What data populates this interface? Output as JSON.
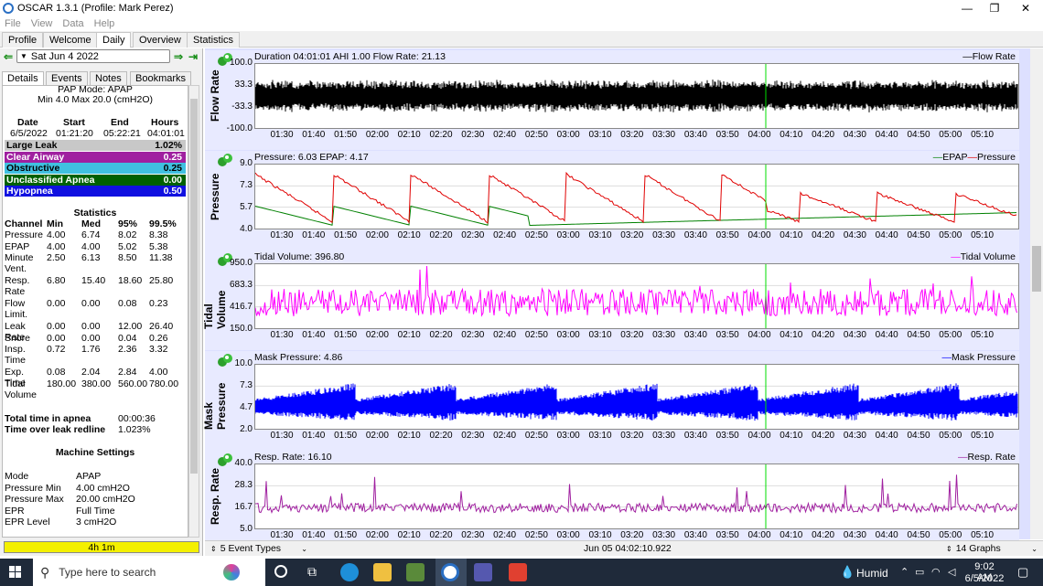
{
  "window": {
    "title": "OSCAR 1.3.1 (Profile: Mark Perez)"
  },
  "menu": [
    "File",
    "View",
    "Data",
    "Help"
  ],
  "tabs": [
    "Profile",
    "Welcome",
    "Daily",
    "Overview",
    "Statistics"
  ],
  "date_nav": {
    "date": "Sat Jun 4 2022"
  },
  "subtabs": [
    "Details",
    "Events",
    "Notes",
    "Bookmarks"
  ],
  "details": {
    "pap_mode": "PAP Mode: APAP",
    "pressure_range": "Min 4.0 Max 20.0 (cmH2O)",
    "session_headers": [
      "Date",
      "Start",
      "End",
      "Hours"
    ],
    "session": [
      "6/5/2022",
      "01:21:20",
      "05:22:21",
      "04:01:01"
    ],
    "events": [
      {
        "name": "Large Leak",
        "value": "1.02%",
        "color": "#c8c8c8",
        "text": "#000"
      },
      {
        "name": "Clear Airway",
        "value": "0.25",
        "color": "#a020a0",
        "text": "#fff"
      },
      {
        "name": "Obstructive",
        "value": "0.25",
        "color": "#40c0e0",
        "text": "#000"
      },
      {
        "name": "Unclassified Apnea",
        "value": "0.00",
        "color": "#006000",
        "text": "#fff"
      },
      {
        "name": "Hypopnea",
        "value": "0.50",
        "color": "#1010e0",
        "text": "#fff"
      }
    ],
    "stats_title": "Statistics",
    "stats_headers": [
      "Channel",
      "Min",
      "Med",
      "95%",
      "99.5%"
    ],
    "stats": [
      {
        "c": "Pressure",
        "v": [
          "4.00",
          "6.74",
          "8.02",
          "8.38"
        ]
      },
      {
        "c": "EPAP",
        "v": [
          "4.00",
          "4.00",
          "5.02",
          "5.38"
        ]
      },
      {
        "c": "Minute Vent.",
        "v": [
          "2.50",
          "6.13",
          "8.50",
          "11.38"
        ]
      },
      {
        "c": "Resp. Rate",
        "v": [
          "6.80",
          "15.40",
          "18.60",
          "25.80"
        ]
      },
      {
        "c": "Flow Limit.",
        "v": [
          "0.00",
          "0.00",
          "0.08",
          "0.23"
        ]
      },
      {
        "c": "Leak Rate",
        "v": [
          "0.00",
          "0.00",
          "12.00",
          "26.40"
        ]
      },
      {
        "c": "Snore",
        "v": [
          "0.00",
          "0.00",
          "0.04",
          "0.26"
        ]
      },
      {
        "c": "Insp. Time",
        "v": [
          "0.72",
          "1.76",
          "2.36",
          "3.32"
        ]
      },
      {
        "c": "Exp. Time",
        "v": [
          "0.08",
          "2.04",
          "2.84",
          "4.00"
        ]
      },
      {
        "c": "Tidal Volume",
        "v": [
          "180.00",
          "380.00",
          "560.00",
          "780.00"
        ]
      }
    ],
    "apnea_label": "Total time in apnea",
    "apnea_value": "00:00:36",
    "leak_label": "Time over leak redline",
    "leak_value": "1.023%",
    "machine_title": "Machine Settings",
    "machine": [
      {
        "k": "Mode",
        "v": "APAP"
      },
      {
        "k": "Pressure Min",
        "v": "4.00 cmH2O"
      },
      {
        "k": "Pressure Max",
        "v": "20.00 cmH2O"
      },
      {
        "k": "EPR",
        "v": "Full Time"
      },
      {
        "k": "EPR Level",
        "v": "3 cmH2O"
      }
    ]
  },
  "hours_bar": "4h 1m",
  "graphs": [
    {
      "id": "flow",
      "ylabel": "Flow Rate",
      "title": "Duration 04:01:01 AHI 1.00 Flow Rate: 21.13",
      "legend": "Flow Rate",
      "yticks": [
        "100.0",
        "33.3",
        "-33.3",
        "-100.0"
      ],
      "color": "#000000"
    },
    {
      "id": "pressure",
      "ylabel": "Pressure",
      "title": "Pressure: 6.03 EPAP: 4.17",
      "legend": "EPAP",
      "legend2": "Pressure",
      "yticks": [
        "9.0",
        "7.3",
        "5.7",
        "4.0"
      ],
      "color": "#e00000",
      "color2": "#008000"
    },
    {
      "id": "tidal",
      "ylabel": "Tidal Volume",
      "title": "Tidal Volume: 396.80",
      "legend": "Tidal Volume",
      "yticks": [
        "950.0",
        "683.3",
        "416.7",
        "150.0"
      ],
      "color": "#ff00ff"
    },
    {
      "id": "mask",
      "ylabel": "Mask Pressure",
      "title": "Mask Pressure: 4.86",
      "legend": "Mask Pressure",
      "yticks": [
        "10.0",
        "7.3",
        "4.7",
        "2.0"
      ],
      "color": "#0000ff"
    },
    {
      "id": "resp",
      "ylabel": "Resp. Rate",
      "title": "Resp. Rate: 16.10",
      "legend": "Resp. Rate",
      "yticks": [
        "40.0",
        "28.3",
        "16.7",
        "5.0"
      ],
      "color": "#a020a0"
    }
  ],
  "xticks": [
    "01:30",
    "01:40",
    "01:50",
    "02:00",
    "02:10",
    "02:20",
    "02:30",
    "02:40",
    "02:50",
    "03:00",
    "03:10",
    "03:20",
    "03:30",
    "03:40",
    "03:50",
    "04:00",
    "04:10",
    "04:20",
    "04:30",
    "04:40",
    "04:50",
    "05:00",
    "05:10"
  ],
  "bottom": {
    "event_types": "5 Event Types",
    "timestamp": "Jun 05 04:02:10.922",
    "graphs_count": "14 Graphs"
  },
  "taskbar": {
    "search_placeholder": "Type here to search",
    "weather": "Humid",
    "time": "9:02 AM",
    "date": "6/5/2022"
  }
}
